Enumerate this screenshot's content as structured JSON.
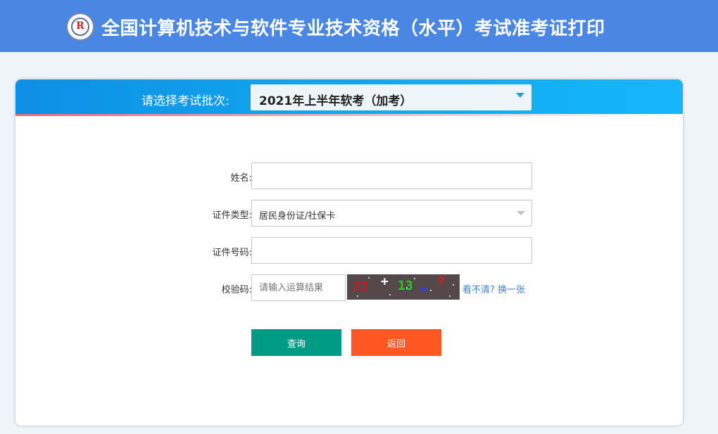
{
  "header": {
    "title": "全国计算机技术与软件专业技术资格（水平）考试准考证打印",
    "logo_mark": "R"
  },
  "batch": {
    "label": "请选择考试批次:",
    "selected": "2021年上半年软考（加考）"
  },
  "form": {
    "name_label": "姓名:",
    "name_value": "",
    "id_type_label": "证件类型:",
    "id_type_selected": "居民身份证/社保卡",
    "id_number_label": "证件号码:",
    "id_number_value": "",
    "captcha_label": "校验码:",
    "captcha_placeholder": "请输入运算结果",
    "captcha_image": {
      "num1": "22",
      "op": "+",
      "num2": "13",
      "eq": "=",
      "q": "?"
    },
    "refresh_link": "看不清? 换一张"
  },
  "buttons": {
    "query": "查询",
    "back": "返回"
  },
  "colors": {
    "header_bg": "#4a86e4",
    "batch_bar": "#12a7ef",
    "query_button": "#009b84",
    "back_button": "#ff5722",
    "link": "#3d82d6"
  }
}
